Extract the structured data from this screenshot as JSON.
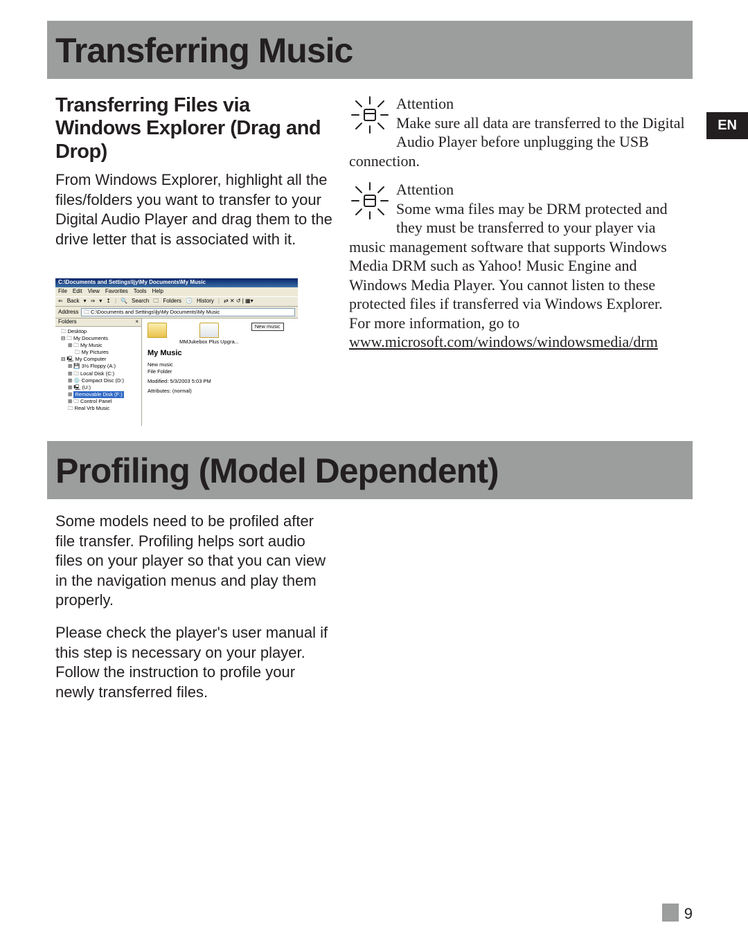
{
  "lang_tab": "EN",
  "page_number": "9",
  "section1": {
    "bar": "Transferring Music",
    "subhead": "Transferring Files via Windows Explorer (Drag and Drop)",
    "body": "From Windows Explorer, highlight all the files/folders you want to transfer to your Digital Audio Player and drag them to the drive letter that is associated with it."
  },
  "attention1": {
    "title": "Attention",
    "body": "Make sure all data are transferred to the Digital Audio Player before unplugging the USB connection."
  },
  "attention2": {
    "title": "Attention",
    "body_part1": "Some wma files may be DRM protected and they must be transferred to your player via music management software that supports Windows Media DRM such as Yahoo! Music Engine and Windows Media Player. You cannot listen to these protected files if transferred via Windows Explorer.",
    "body_part2": "For more information, go to ",
    "link": "www.microsoft.com/windows/windowsmedia/drm"
  },
  "section2": {
    "bar": "Profiling (Model Dependent)",
    "p1": "Some models need to be profiled after file transfer. Profiling helps sort audio files on your player so that you can view in the navigation menus and play them properly.",
    "p2": "Please check the player's user manual if this step is necessary on your player. Follow the instruction to profile your newly transferred files."
  },
  "explorer": {
    "title": "C:\\Documents and Settings\\ljy\\My Documents\\My Music",
    "menus": [
      "File",
      "Edit",
      "View",
      "Favorites",
      "Tools",
      "Help"
    ],
    "toolbar": {
      "back": "Back",
      "search": "Search",
      "folders": "Folders",
      "history": "History"
    },
    "address_label": "Address",
    "address_value": "C:\\Documents and Settings\\ljy\\My Documents\\My Music",
    "folders_label": "Folders",
    "close_x": "×",
    "tree": {
      "desktop": "Desktop",
      "mydocs": "My Documents",
      "mymusic": "My Music",
      "mypictures": "My Pictures",
      "mycomputer": "My Computer",
      "floppy": "3½ Floppy (A:)",
      "localdisk": "Local Disk (C:)",
      "compactdisc": "Compact Disc (D:)",
      "udrive": "(U:)",
      "removable": "Removable Disk (F:)",
      "controlpanel": "Control Panel",
      "realmusic": "Real Vrb Music"
    },
    "content": {
      "icon1_label": "MMJukebox Plus Upgra...",
      "button": "New music",
      "heading": "My Music",
      "meta_newmusic": "New music",
      "meta_filefolder": "File Folder",
      "meta_modified": "Modified: 5/3/2003 5:03 PM",
      "meta_attributes": "Attributes: (normal)"
    }
  }
}
